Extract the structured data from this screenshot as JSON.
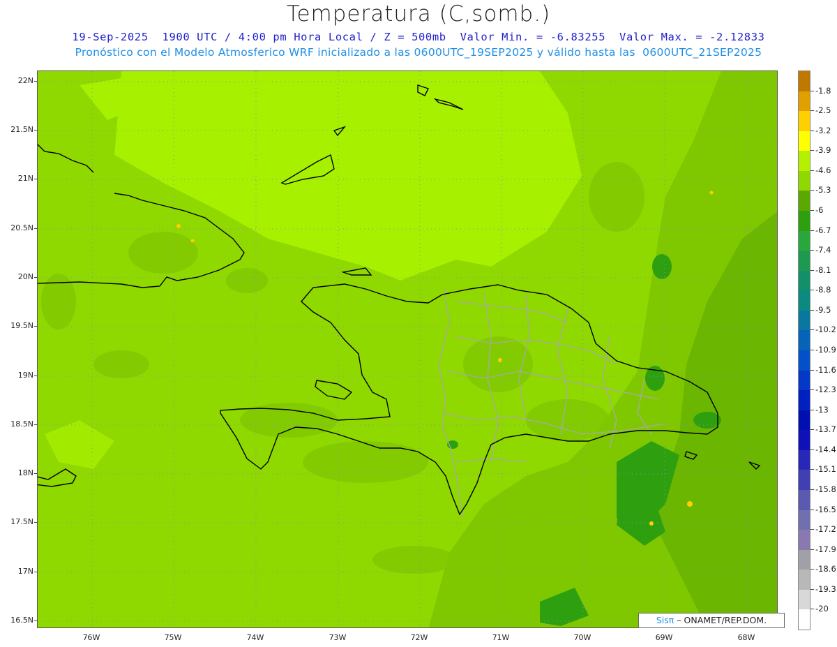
{
  "header": {
    "title": "Temperatura (C,somb.)",
    "line1": "19-Sep-2025  1900 UTC / 4:00 pm Hora Local / Z = 500mb  Valor Min. = -6.83255  Valor Max. = -2.12833",
    "line2": "Pronóstico con el Modelo Atmosferico WRF inicializado a las 0600UTC_19SEP2025 y válido hasta las  0600UTC_21SEP2025"
  },
  "map": {
    "lat_labels": [
      "22N",
      "21.5N",
      "21N",
      "20.5N",
      "20N",
      "19.5N",
      "19N",
      "18.5N",
      "18N",
      "17.5N",
      "17N",
      "16.5N"
    ],
    "lon_labels": [
      "76W",
      "75W",
      "74W",
      "73W",
      "72W",
      "71W",
      "70W",
      "69W",
      "68W"
    ],
    "colors": {
      "light": "#a6f000",
      "mid": "#8fd800",
      "base": "#7fc800",
      "dark": "#5aa800",
      "darker": "#2ea010",
      "coast": "#000000",
      "border": "#a8a8a8",
      "grid": "#8a8ad0"
    }
  },
  "colorbar": {
    "labels": [
      "-1.8",
      "-2.5",
      "-3.2",
      "-3.9",
      "-4.6",
      "-5.3",
      "-6",
      "-6.7",
      "-7.4",
      "-8.1",
      "-8.8",
      "-9.5",
      "-10.2",
      "-10.9",
      "-11.6",
      "-12.3",
      "-13",
      "-13.7",
      "-14.4",
      "-15.1",
      "-15.8",
      "-16.5",
      "-17.2",
      "-17.9",
      "-18.6",
      "-19.3",
      "-20"
    ],
    "colors": [
      "#c07800",
      "#e0a000",
      "#ffd000",
      "#ffff00",
      "#b4f000",
      "#8fd800",
      "#5aa800",
      "#2ea010",
      "#28a83c",
      "#1e9a50",
      "#12906a",
      "#0a8a80",
      "#0878a0",
      "#0664b8",
      "#0450c8",
      "#0338c8",
      "#0020c0",
      "#0010b0",
      "#1010b8",
      "#2828b8",
      "#4040b4",
      "#5a5ab0",
      "#7070b0",
      "#8a78b0",
      "#a0a0a8",
      "#b8b8b8",
      "#d8d8d8",
      "#ffffff"
    ]
  },
  "credit": {
    "sis": "Sisπ",
    "text": "– ONAMET/REP.DOM."
  }
}
